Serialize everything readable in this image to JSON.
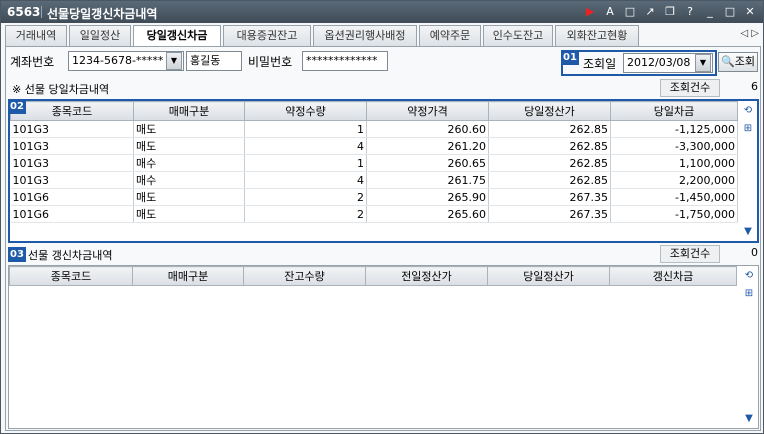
{
  "window": {
    "code": "6563",
    "title": "선물당일갱신차금내역",
    "icons": [
      "record-icon",
      "font-icon",
      "window-icon",
      "popout-icon",
      "restore-icon",
      "help-icon",
      "minimize-icon",
      "maximize-icon",
      "close-icon"
    ],
    "icon_glyphs": [
      "▶",
      "A",
      "□",
      "↗",
      "❐",
      "?",
      "_",
      "□",
      "✕"
    ]
  },
  "tabs": [
    "거래내역",
    "일일정산",
    "당일갱신차금",
    "대용증권잔고",
    "옵션권리행사배정",
    "예약주문",
    "인수도잔고",
    "외화잔고현황"
  ],
  "active_tab": 2,
  "tab_nav": "◁ ▷",
  "form": {
    "account_label": "계좌번호",
    "account_value": "1234-5678-*****",
    "name_value": "홍길동",
    "password_label": "비밀번호",
    "password_value": "*************",
    "date_badge": "01",
    "date_label": "조회일",
    "date_value": "2012/03/08",
    "search_button": "조회"
  },
  "section1": {
    "title": "※ 선물 당일차금내역",
    "count_label": "조회건수",
    "count_value": "6",
    "badge": "02",
    "columns": [
      "종목코드",
      "매매구분",
      "약정수량",
      "약정가격",
      "당일정산가",
      "당일차금"
    ],
    "rows": [
      [
        "101G3",
        "매도",
        "1",
        "260.60",
        "262.85",
        "-1,125,000"
      ],
      [
        "101G3",
        "매도",
        "4",
        "261.20",
        "262.85",
        "-3,300,000"
      ],
      [
        "101G3",
        "매수",
        "1",
        "260.65",
        "262.85",
        "1,100,000"
      ],
      [
        "101G3",
        "매수",
        "4",
        "261.75",
        "262.85",
        "2,200,000"
      ],
      [
        "101G6",
        "매도",
        "2",
        "265.90",
        "267.35",
        "-1,450,000"
      ],
      [
        "101G6",
        "매도",
        "2",
        "265.60",
        "267.35",
        "-1,750,000"
      ]
    ]
  },
  "section2": {
    "badge": "03",
    "title": "선물 갱신차금내역",
    "count_label": "조회건수",
    "count_value": "0",
    "columns": [
      "종목코드",
      "매매구분",
      "잔고수량",
      "전일정산가",
      "당일정산가",
      "갱신차금"
    ]
  },
  "colors": {
    "accent": "#1e5aa8",
    "titlebar": "#4b5763"
  }
}
